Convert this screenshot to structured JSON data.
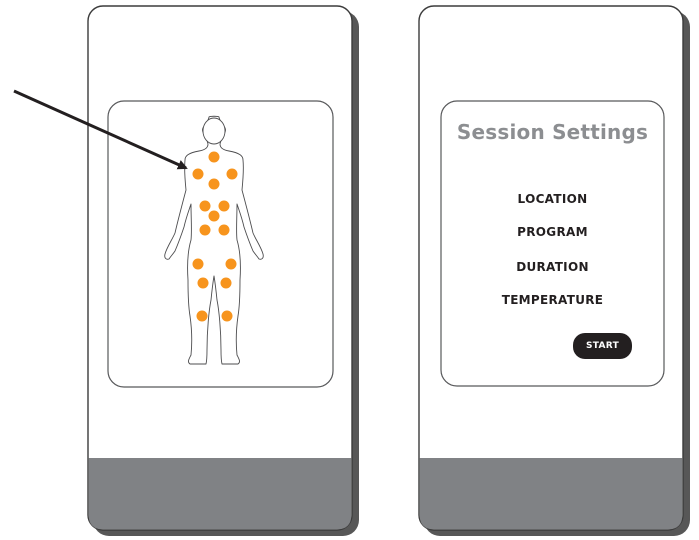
{
  "body_map": {
    "body_outline_icon": "human-body-outline-icon",
    "marker_color": "#f7941d",
    "marker_core_color": "#e8731a"
  },
  "session": {
    "title": "Session Settings",
    "items": [
      {
        "label": "LOCATION"
      },
      {
        "label": "PROGRAM"
      },
      {
        "label": "DURATION"
      },
      {
        "label": "TEMPERATURE"
      }
    ],
    "start_label": "START"
  },
  "colors": {
    "footer": "#808285",
    "title": "#8c8e91",
    "button": "#231f20"
  }
}
